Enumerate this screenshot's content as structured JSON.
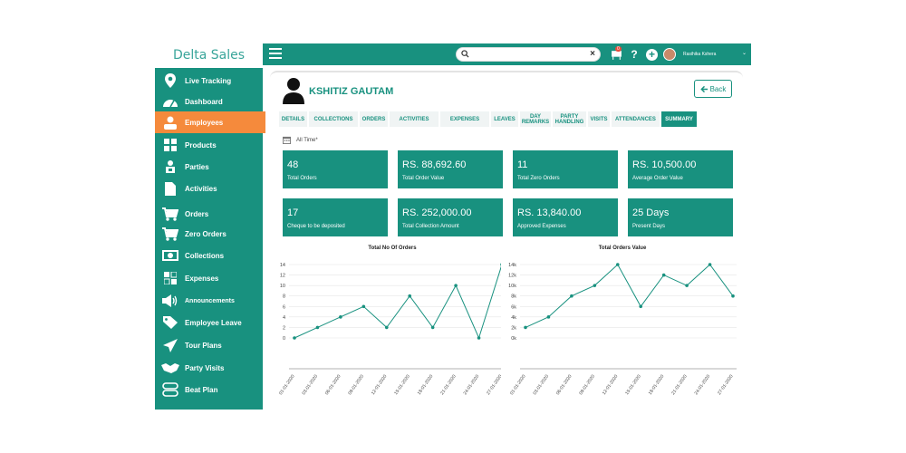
{
  "app": {
    "brand": "Delta Sales"
  },
  "sidebar": {
    "items": [
      {
        "label": "Live Tracking",
        "icon": "map-pin-icon"
      },
      {
        "label": "Dashboard",
        "icon": "gauge-icon"
      },
      {
        "label": "Employees",
        "icon": "person-icon"
      },
      {
        "label": "Products",
        "icon": "grid-icon"
      },
      {
        "label": "Parties",
        "icon": "group-icon"
      },
      {
        "label": "Activities",
        "icon": "document-icon"
      },
      {
        "label": "Orders",
        "icon": "cart-icon"
      },
      {
        "label": "Zero Orders",
        "icon": "cart-icon"
      },
      {
        "label": "Collections",
        "icon": "money-icon"
      },
      {
        "label": "Expenses",
        "icon": "expense-icon"
      },
      {
        "label": "Announcements",
        "icon": "megaphone-icon"
      },
      {
        "label": "Employee Leave",
        "icon": "tag-icon"
      },
      {
        "label": "Tour Plans",
        "icon": "paper-plane-icon"
      },
      {
        "label": "Party Visits",
        "icon": "handshake-icon"
      },
      {
        "label": "Beat Plan",
        "icon": "layers-icon"
      }
    ],
    "active_index": 2
  },
  "topbar": {
    "search_placeholder": "",
    "clear_symbol": "×",
    "notification_count": "0",
    "help_symbol": "?",
    "add_symbol": "+",
    "user_name": "Rasihika Kshera",
    "caret_symbol": "⌄"
  },
  "employee": {
    "name": "KSHITIZ GAUTAM"
  },
  "back_label": "Back",
  "tabs": [
    {
      "label": "DETAILS"
    },
    {
      "label": "COLLECTIONS"
    },
    {
      "label": "ORDERS"
    },
    {
      "label": "ACTIVITIES"
    },
    {
      "label": "EXPENSES"
    },
    {
      "label": "LEAVES"
    },
    {
      "label": "DAY REMARKS"
    },
    {
      "label": "PARTY HANDLING"
    },
    {
      "label": "VISITS"
    },
    {
      "label": "ATTENDANCES"
    },
    {
      "label": "SUMMARY"
    }
  ],
  "filter": {
    "label": "All Time*"
  },
  "stats": [
    {
      "value": "48",
      "label": "Total Orders"
    },
    {
      "value": "RS. 88,692.60",
      "label": "Total Order Value"
    },
    {
      "value": "11",
      "label": "Total Zero Orders"
    },
    {
      "value": "RS. 10,500.00",
      "label": "Average Order Value"
    },
    {
      "value": "17",
      "label": "Cheque to be deposited"
    },
    {
      "value": "RS. 252,000.00",
      "label": "Total Collection Amount"
    },
    {
      "value": "RS. 13,840.00",
      "label": "Approved Expenses"
    },
    {
      "value": "25 Days",
      "label": "Present Days"
    }
  ],
  "colors": {
    "primary": "#18917f",
    "accent": "#f58a3c"
  },
  "chart_data": [
    {
      "type": "line",
      "title": "Total No Of Orders",
      "x": [
        "01-01-2020",
        "03-01-2020",
        "06-01-2020",
        "09-01-2020",
        "12-01-2020",
        "15-01-2020",
        "18-01-2020",
        "21-01-2020",
        "24-01-2020",
        "27-01-2020"
      ],
      "values": [
        0,
        2,
        4,
        6,
        2,
        8,
        2,
        10,
        0,
        14
      ],
      "yticks": [
        "0",
        "2",
        "4",
        "6",
        "8",
        "10",
        "12",
        "14"
      ],
      "ylim": [
        0,
        14
      ]
    },
    {
      "type": "line",
      "title": "Total Orders Value",
      "x": [
        "01-01-2020",
        "03-01-2020",
        "06-01-2020",
        "09-01-2020",
        "12-01-2020",
        "15-01-2020",
        "18-01-2020",
        "21-01-2020",
        "24-01-2020",
        "27-01-2020"
      ],
      "values": [
        2000,
        4000,
        8000,
        10000,
        14000,
        6000,
        12000,
        10000,
        14000,
        8000
      ],
      "yticks": [
        "0k",
        "2k",
        "4k",
        "6k",
        "8k",
        "10k",
        "12k",
        "14k"
      ],
      "ylim": [
        0,
        14000
      ]
    }
  ]
}
